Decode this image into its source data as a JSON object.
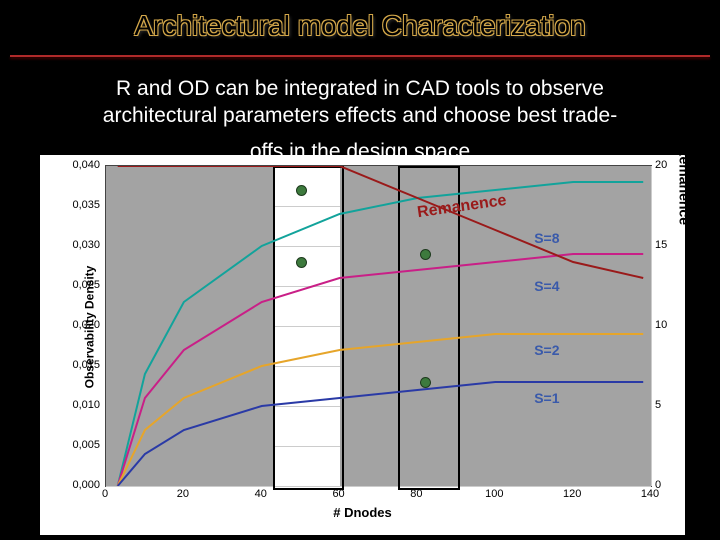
{
  "title": "Architectural model Characterization",
  "subtitle_l1": "R and OD can be integrated in CAD tools to observe",
  "subtitle_l2": "architectural parameters effects and choose best trade-",
  "subtitle_l3": "offs in the design space",
  "chart_data": {
    "type": "line",
    "title": "",
    "xlabel": "# Dnodes",
    "ylabel": "Observability Density",
    "y2label": "Remanence",
    "xlim": [
      0,
      140
    ],
    "ylim": [
      0,
      0.04
    ],
    "y2lim": [
      0,
      20
    ],
    "x_ticks": [
      0,
      20,
      40,
      60,
      80,
      100,
      120,
      140
    ],
    "y_ticks": [
      "0,000",
      "0,005",
      "0,010",
      "0,015",
      "0,020",
      "0,025",
      "0,030",
      "0,035",
      "0,040"
    ],
    "y2_ticks": [
      0,
      5,
      10,
      15,
      20
    ],
    "shade_regions_x": [
      [
        0,
        43
      ],
      [
        60,
        140
      ]
    ],
    "highlight_cols_x": [
      [
        43,
        60
      ],
      [
        75,
        90
      ]
    ],
    "annotation": "Remanence",
    "series": [
      {
        "name": "S=8",
        "color": "#12a39b",
        "x": [
          3,
          10,
          20,
          40,
          60,
          80,
          100,
          120,
          138
        ],
        "values": [
          0.0,
          0.014,
          0.023,
          0.03,
          0.034,
          0.036,
          0.037,
          0.038,
          0.038
        ]
      },
      {
        "name": "S=4",
        "color": "#c91f87",
        "x": [
          3,
          10,
          20,
          40,
          60,
          80,
          100,
          120,
          138
        ],
        "values": [
          0.0,
          0.011,
          0.017,
          0.023,
          0.026,
          0.027,
          0.028,
          0.029,
          0.029
        ]
      },
      {
        "name": "S=2",
        "color": "#e6a52a",
        "x": [
          3,
          10,
          20,
          40,
          60,
          80,
          100,
          120,
          138
        ],
        "values": [
          0.0,
          0.007,
          0.011,
          0.015,
          0.017,
          0.018,
          0.019,
          0.019,
          0.019
        ]
      },
      {
        "name": "S=1",
        "color": "#2a3aa6",
        "x": [
          3,
          10,
          20,
          40,
          60,
          80,
          100,
          120,
          138
        ],
        "values": [
          0.0,
          0.004,
          0.007,
          0.01,
          0.011,
          0.012,
          0.013,
          0.013,
          0.013
        ]
      },
      {
        "name": "Remanence",
        "axis": "y2",
        "color": "#9a1a1a",
        "x": [
          3,
          20,
          40,
          60,
          80,
          100,
          120,
          138
        ],
        "values": [
          20,
          20,
          20,
          20,
          18,
          16,
          14,
          13
        ]
      }
    ],
    "marker_points": [
      {
        "x": 50,
        "y": 0.037
      },
      {
        "x": 50,
        "y": 0.028
      },
      {
        "x": 82,
        "y": 0.029
      },
      {
        "x": 82,
        "y": 0.013
      }
    ],
    "curve_labels": [
      {
        "text": "S=8",
        "x": 110,
        "y": 0.031
      },
      {
        "text": "S=4",
        "x": 110,
        "y": 0.025
      },
      {
        "text": "S=2",
        "x": 110,
        "y": 0.017
      },
      {
        "text": "S=1",
        "x": 110,
        "y": 0.011
      }
    ]
  }
}
